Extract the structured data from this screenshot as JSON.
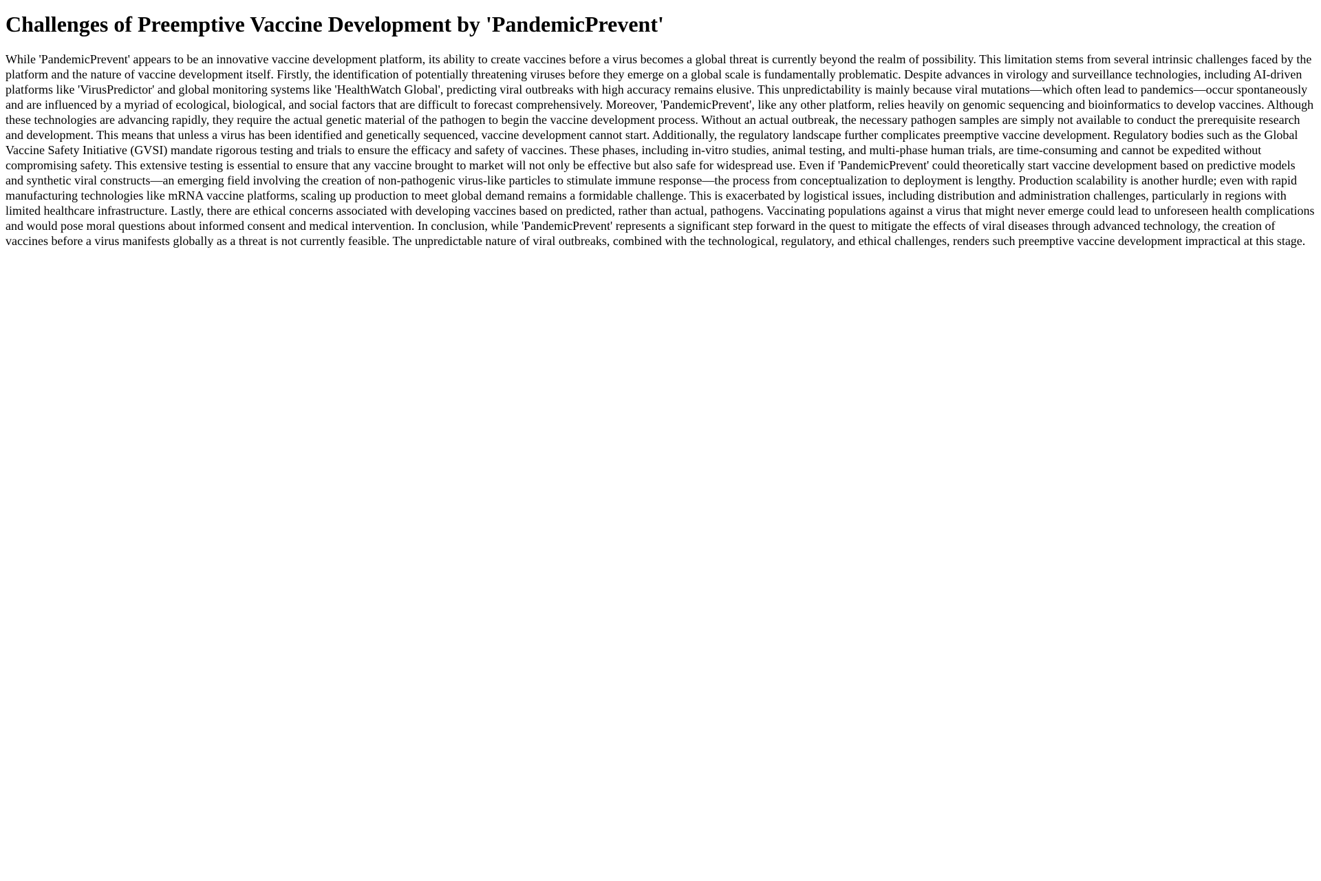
{
  "page": {
    "title": "Challenges of Preemptive Vaccine Development by 'PandemicPrevent'",
    "body": "While 'PandemicPrevent' appears to be an innovative vaccine development platform, its ability to create vaccines before a virus becomes a global threat is currently beyond the realm of possibility. This limitation stems from several intrinsic challenges faced by the platform and the nature of vaccine development itself. Firstly, the identification of potentially threatening viruses before they emerge on a global scale is fundamentally problematic. Despite advances in virology and surveillance technologies, including AI-driven platforms like 'VirusPredictor' and global monitoring systems like 'HealthWatch Global', predicting viral outbreaks with high accuracy remains elusive. This unpredictability is mainly because viral mutations—which often lead to pandemics—occur spontaneously and are influenced by a myriad of ecological, biological, and social factors that are difficult to forecast comprehensively. Moreover, 'PandemicPrevent', like any other platform, relies heavily on genomic sequencing and bioinformatics to develop vaccines. Although these technologies are advancing rapidly, they require the actual genetic material of the pathogen to begin the vaccine development process. Without an actual outbreak, the necessary pathogen samples are simply not available to conduct the prerequisite research and development. This means that unless a virus has been identified and genetically sequenced, vaccine development cannot start. Additionally, the regulatory landscape further complicates preemptive vaccine development. Regulatory bodies such as the Global Vaccine Safety Initiative (GVSI) mandate rigorous testing and trials to ensure the efficacy and safety of vaccines. These phases, including in-vitro studies, animal testing, and multi-phase human trials, are time-consuming and cannot be expedited without compromising safety. This extensive testing is essential to ensure that any vaccine brought to market will not only be effective but also safe for widespread use. Even if 'PandemicPrevent' could theoretically start vaccine development based on predictive models and synthetic viral constructs—an emerging field involving the creation of non-pathogenic virus-like particles to stimulate immune response—the process from conceptualization to deployment is lengthy. Production scalability is another hurdle; even with rapid manufacturing technologies like mRNA vaccine platforms, scaling up production to meet global demand remains a formidable challenge. This is exacerbated by logistical issues, including distribution and administration challenges, particularly in regions with limited healthcare infrastructure. Lastly, there are ethical concerns associated with developing vaccines based on predicted, rather than actual, pathogens. Vaccinating populations against a virus that might never emerge could lead to unforeseen health complications and would pose moral questions about informed consent and medical intervention. In conclusion, while 'PandemicPrevent' represents a significant step forward in the quest to mitigate the effects of viral diseases through advanced technology, the creation of vaccines before a virus manifests globally as a threat is not currently feasible. The unpredictable nature of viral outbreaks, combined with the technological, regulatory, and ethical challenges, renders such preemptive vaccine development impractical at this stage."
  }
}
